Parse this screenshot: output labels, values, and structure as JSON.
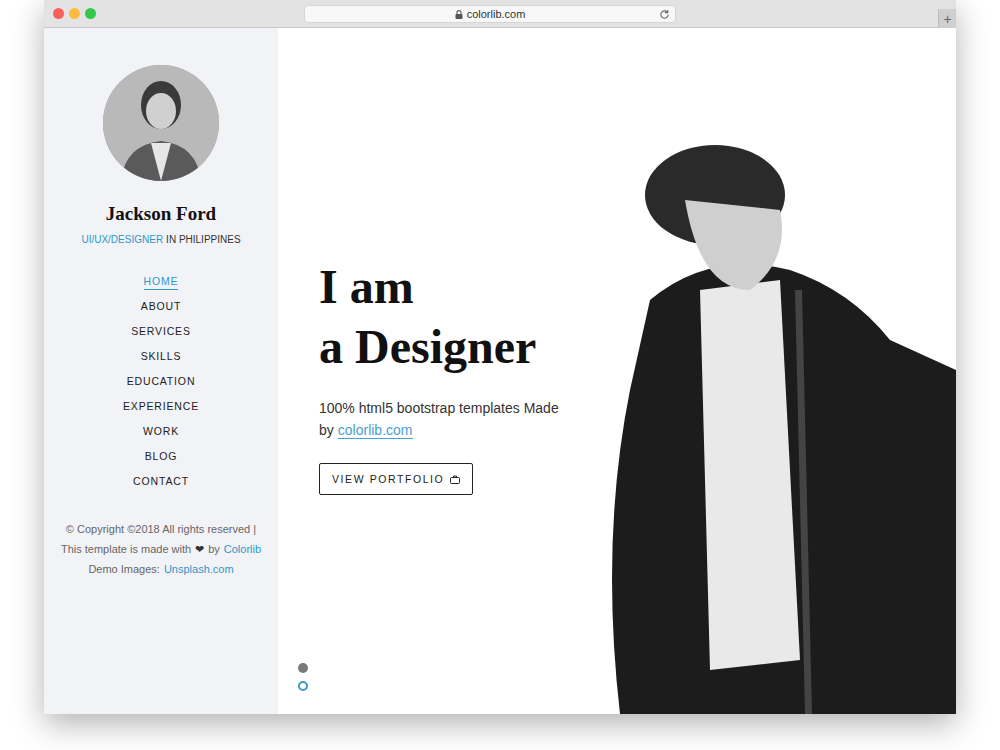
{
  "browser": {
    "url": "colorlib.com",
    "new_tab": "+"
  },
  "sidebar": {
    "name": "Jackson Ford",
    "role": "UI/UX/DESIGNER",
    "location": "IN PHILIPPINES",
    "nav": [
      {
        "label": "HOME",
        "selected": true
      },
      {
        "label": "ABOUT",
        "selected": false
      },
      {
        "label": "SERVICES",
        "selected": false
      },
      {
        "label": "SKILLS",
        "selected": false
      },
      {
        "label": "EDUCATION",
        "selected": false
      },
      {
        "label": "EXPERIENCE",
        "selected": false
      },
      {
        "label": "WORK",
        "selected": false
      },
      {
        "label": "BLOG",
        "selected": false
      },
      {
        "label": "CONTACT",
        "selected": false
      }
    ],
    "footer": {
      "copyright": "© Copyright ©2018 All rights reserved | This template is made with",
      "heart": "❤",
      "by": "by",
      "brand": "Colorlib",
      "images_label": "Demo Images:",
      "images_link": "Unsplash.com"
    }
  },
  "hero": {
    "heading": [
      "I am",
      "a Designer"
    ],
    "text": "100% html5 bootstrap templates Made by",
    "link": "colorlib.com",
    "button": "VIEW PORTFOLIO",
    "slides": [
      {
        "selected": false
      },
      {
        "selected": true
      }
    ]
  }
}
